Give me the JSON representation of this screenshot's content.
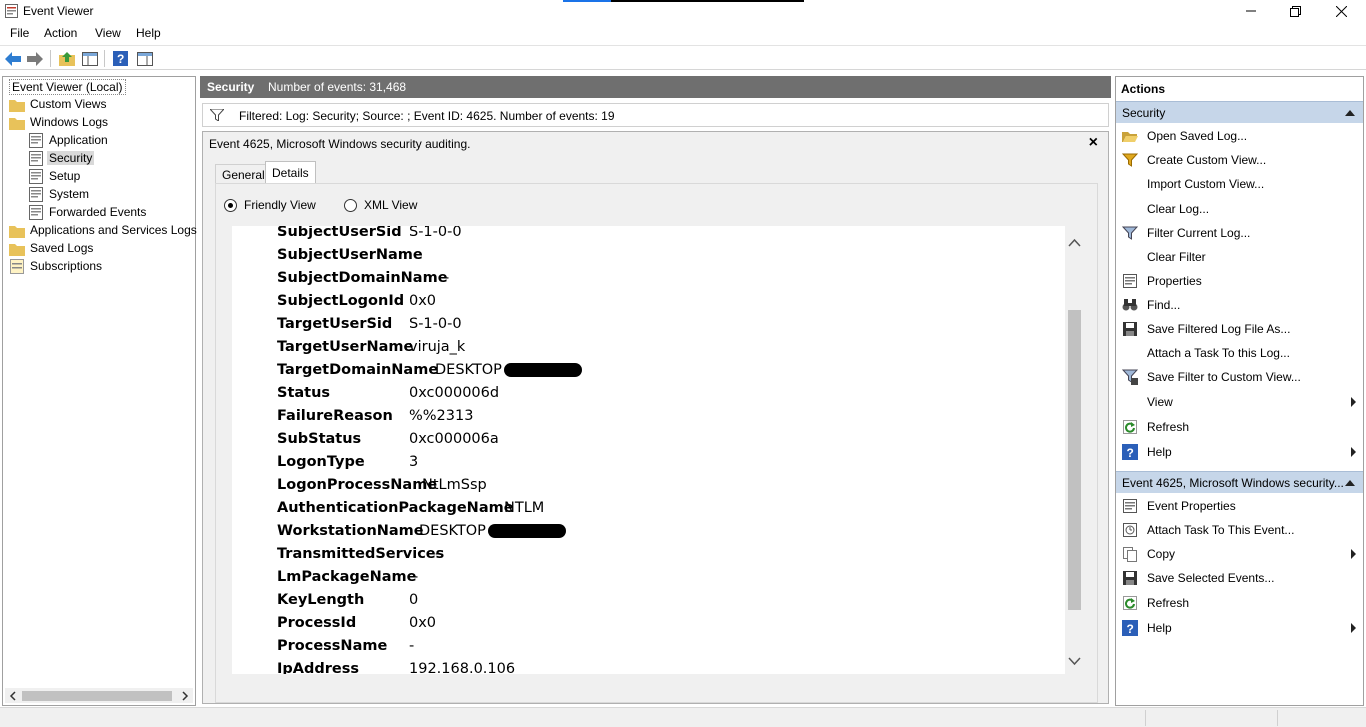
{
  "window": {
    "title": "Event Viewer"
  },
  "menu": [
    "File",
    "Action",
    "View",
    "Help"
  ],
  "tree": {
    "root": "Event Viewer (Local)",
    "custom_views": "Custom Views",
    "windows_logs": "Windows Logs",
    "application": "Application",
    "security": "Security",
    "setup": "Setup",
    "system": "System",
    "forwarded": "Forwarded Events",
    "apps_services": "Applications and Services Logs",
    "saved_logs": "Saved Logs",
    "subscriptions": "Subscriptions"
  },
  "log_header": {
    "name": "Security",
    "count": "Number of events: 31,468"
  },
  "filter": {
    "text": "Filtered: Log: Security; Source: ; Event ID: 4625. Number of events: 19"
  },
  "event": {
    "title": "Event 4625, Microsoft Windows security auditing.",
    "close": "×",
    "tabs": {
      "general": "General",
      "details": "Details"
    },
    "views": {
      "friendly": "Friendly View",
      "xml": "XML View"
    },
    "fields": [
      {
        "key": "SubjectUserSid",
        "value": "S-1-0-0"
      },
      {
        "key": "SubjectUserName",
        "value": "-"
      },
      {
        "key": "SubjectDomainName",
        "value": "-"
      },
      {
        "key": "SubjectLogonId",
        "value": "0x0"
      },
      {
        "key": "TargetUserSid",
        "value": "S-1-0-0"
      },
      {
        "key": "TargetUserName",
        "value": "viruja_k"
      },
      {
        "key": "TargetDomainName",
        "value": "DESKTOP",
        "redacted": true
      },
      {
        "key": "Status",
        "value": "0xc000006d"
      },
      {
        "key": "FailureReason",
        "value": "%%2313"
      },
      {
        "key": "SubStatus",
        "value": "0xc000006a"
      },
      {
        "key": "LogonType",
        "value": "3"
      },
      {
        "key": "LogonProcessName",
        "value": "NtLmSsp"
      },
      {
        "key": "AuthenticationPackageName",
        "value": "NTLM"
      },
      {
        "key": "WorkstationName",
        "value": "DESKTOP",
        "redacted": true
      },
      {
        "key": "TransmittedServices",
        "value": "-"
      },
      {
        "key": "LmPackageName",
        "value": "-"
      },
      {
        "key": "KeyLength",
        "value": "0"
      },
      {
        "key": "ProcessId",
        "value": "0x0"
      },
      {
        "key": "ProcessName",
        "value": "-"
      },
      {
        "key": "IpAddress",
        "value": "192.168.0.106"
      }
    ]
  },
  "actions": {
    "header": "Actions",
    "security_section": "Security",
    "security_items": [
      {
        "label": "Open Saved Log...",
        "icon": "open-folder-icon"
      },
      {
        "label": "Create Custom View...",
        "icon": "filter-create-icon"
      },
      {
        "label": "Import Custom View...",
        "icon": ""
      },
      {
        "label": "Clear Log...",
        "icon": ""
      },
      {
        "label": "Filter Current Log...",
        "icon": "filter-icon"
      },
      {
        "label": "Clear Filter",
        "icon": ""
      },
      {
        "label": "Properties",
        "icon": "properties-icon"
      },
      {
        "label": "Find...",
        "icon": "binoculars-icon"
      },
      {
        "label": "Save Filtered Log File As...",
        "icon": "save-icon"
      },
      {
        "label": "Attach a Task To this Log...",
        "icon": ""
      },
      {
        "label": "Save Filter to Custom View...",
        "icon": "filter-save-icon"
      },
      {
        "label": "View",
        "icon": "",
        "submenu": true
      },
      {
        "label": "Refresh",
        "icon": "refresh-icon"
      },
      {
        "label": "Help",
        "icon": "help-icon",
        "submenu": true
      }
    ],
    "event_section": "Event 4625, Microsoft Windows security...",
    "event_items": [
      {
        "label": "Event Properties",
        "icon": "properties-icon"
      },
      {
        "label": "Attach Task To This Event...",
        "icon": "task-icon"
      },
      {
        "label": "Copy",
        "icon": "copy-icon",
        "submenu": true
      },
      {
        "label": "Save Selected Events...",
        "icon": "save-icon"
      },
      {
        "label": "Refresh",
        "icon": "refresh-icon"
      },
      {
        "label": "Help",
        "icon": "help-icon",
        "submenu": true
      }
    ]
  }
}
